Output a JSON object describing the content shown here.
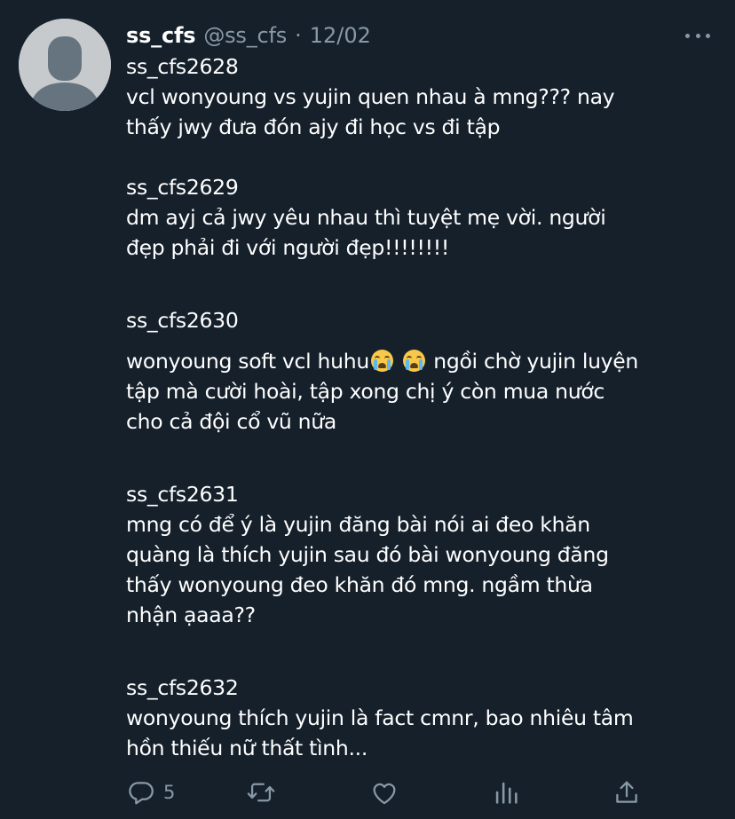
{
  "tweet": {
    "display_name": "ss_cfs",
    "handle": "@ss_cfs",
    "separator": "·",
    "date": "12/02",
    "more_icon": "more-horizontal-icon",
    "avatar_icon": "default-avatar-icon"
  },
  "posts": [
    {
      "user": "ss_cfs2628",
      "lines": [
        "vcl wonyoung vs yujin quen nhau à mng??? nay",
        "thấy jwy đưa đón ajy đi học vs đi tập"
      ]
    },
    {
      "user": "ss_cfs2629",
      "lines": [
        "dm ayj cả jwy yêu nhau thì tuyệt mẹ vời. người",
        "đẹp phải đi với người đẹp!!!!!!!!"
      ]
    },
    {
      "user": "ss_cfs2630",
      "line1_a": "wonyoung soft vcl huhu",
      "line1_b": " ngồi chờ yujin luyện",
      "emoji_icon": "loudly-crying-face-emoji",
      "lines": [
        "tập mà cười hoài, tập xong chị ý còn mua nước",
        "cho cả đội cổ vũ nữa"
      ]
    },
    {
      "user": "ss_cfs2631",
      "lines": [
        "mng có để ý là yujin đăng bài nói ai đeo khăn",
        "quàng là thích yujin sau đó bài wonyoung đăng",
        "thấy wonyoung đeo khăn đó mng. ngầm thừa",
        "nhận ạaaa??"
      ]
    },
    {
      "user": "ss_cfs2632",
      "lines": [
        "wonyoung thích yujin là fact cmnr, bao nhiêu tâm",
        "hồn thiếu nữ thất tình..."
      ]
    }
  ],
  "actions": {
    "reply_count": "5",
    "icons": [
      "reply-icon",
      "retweet-icon",
      "like-icon",
      "analytics-icon",
      "share-icon"
    ]
  },
  "colors": {
    "background": "#15202b",
    "text": "#ffffff",
    "secondary": "#8899a6",
    "avatar": "#c6cacd"
  }
}
